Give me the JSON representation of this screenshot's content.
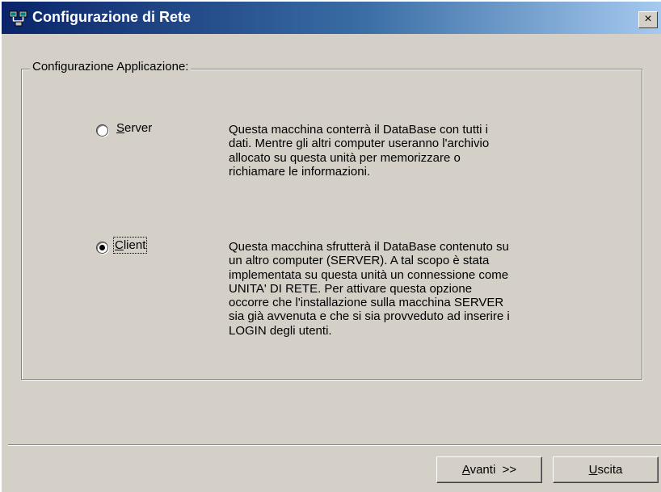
{
  "window": {
    "title": "Configurazione di Rete",
    "close_label": "×"
  },
  "group": {
    "legend": "Configurazione Applicazione:"
  },
  "options": [
    {
      "mnemonic": "S",
      "label_rest": "erver",
      "selected": false,
      "description": [
        "Questa macchina conterrà il DataBase con tutti i",
        "dati. Mentre gli altri computer useranno l'archivio",
        "allocato su questa unità per memorizzare o",
        "richiamare le informazioni."
      ]
    },
    {
      "mnemonic": "C",
      "label_rest": "lient",
      "selected": true,
      "description": [
        "Questa macchina sfrutterà il DataBase contenuto su",
        "un altro computer (SERVER). A tal scopo è stata",
        "implementata su questa unità un connessione come",
        "UNITA' DI RETE. Per attivare questa opzione",
        "occorre che l'installazione sulla macchina SERVER",
        "sia già avvenuta e che si sia provveduto ad inserire i",
        "LOGIN degli utenti."
      ]
    }
  ],
  "buttons": {
    "next": {
      "mnemonic": "A",
      "rest": "vanti  >>"
    },
    "exit": {
      "mnemonic": "U",
      "rest": "scita"
    }
  },
  "colors": {
    "titlebar_start": "#0a246a",
    "titlebar_end": "#a6caf0",
    "face": "#d4d0c8"
  }
}
